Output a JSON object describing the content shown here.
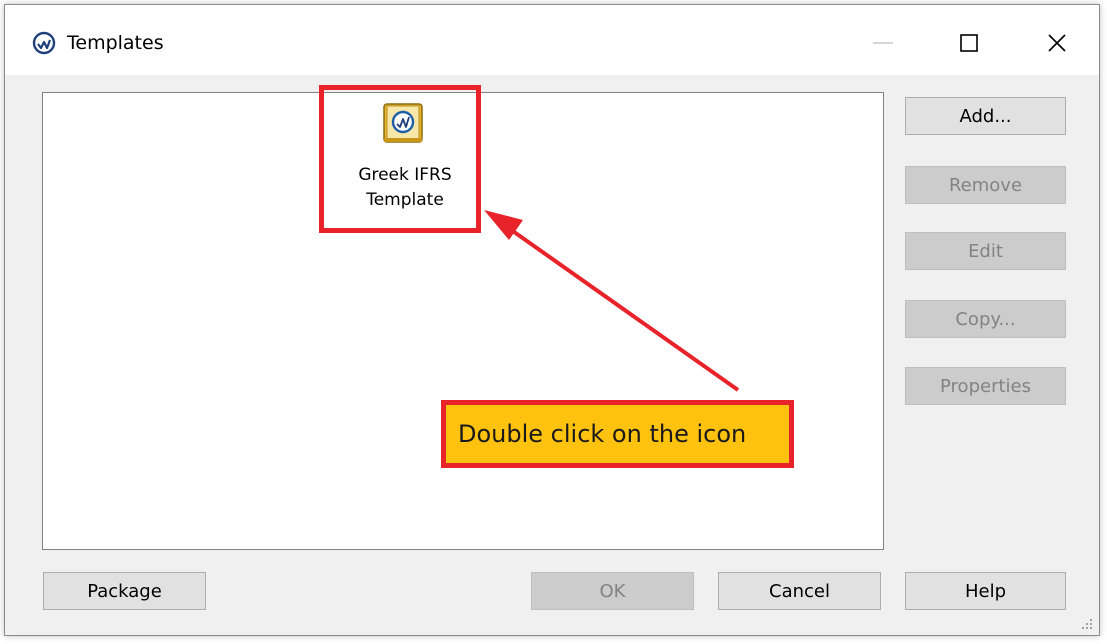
{
  "window": {
    "title": "Templates"
  },
  "templates": {
    "items": [
      {
        "label": "Greek IFRS\nTemplate",
        "icon": "template-book-icon"
      }
    ]
  },
  "buttons": {
    "add": "Add...",
    "remove": "Remove",
    "edit": "Edit",
    "copy": "Copy...",
    "properties": "Properties",
    "package": "Package",
    "ok": "OK",
    "cancel": "Cancel",
    "help": "Help"
  },
  "annotation": {
    "callout_text": "Double click on the icon"
  },
  "colors": {
    "highlight": "#e8232a",
    "callout_fill": "#ffc20e",
    "icon_gold": "#e8b62c",
    "icon_blue": "#1f5fa8"
  }
}
